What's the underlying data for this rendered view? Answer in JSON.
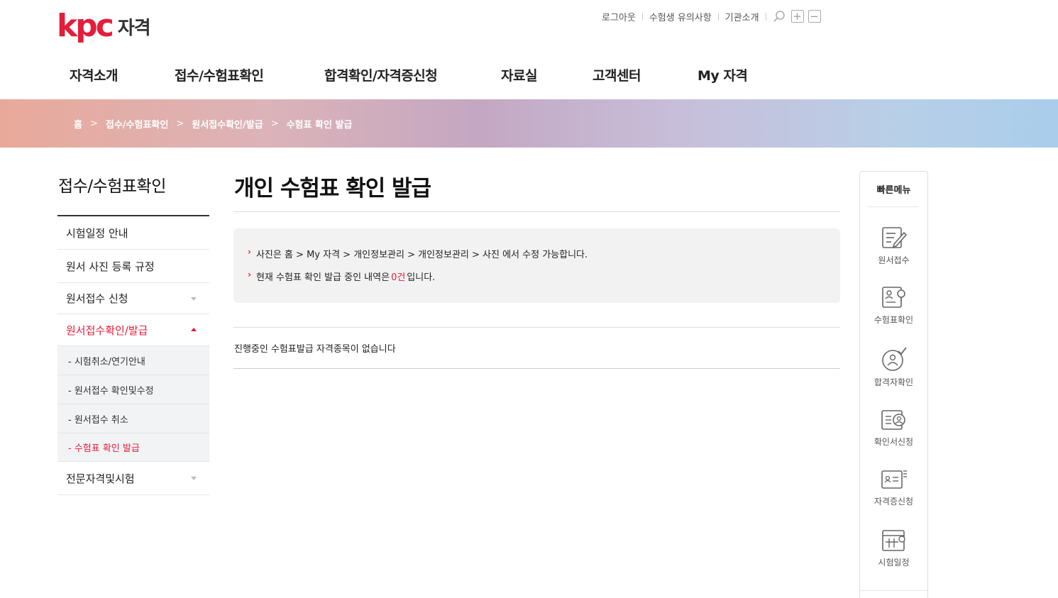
{
  "logo": {
    "brand": "kpc",
    "sub": "자격"
  },
  "util": {
    "logout": "로그아웃",
    "notice": "수험생 유의사항",
    "about": "기관소개",
    "zoom_in": "+",
    "zoom_out": "−"
  },
  "gnb": [
    "자격소개",
    "접수/수험표확인",
    "합격확인/자격증신청",
    "자료실",
    "고객센터",
    "My 자격"
  ],
  "breadcrumb": {
    "home": "홈",
    "level1": "접수/수험표확인",
    "level2": "원서접수확인/발급",
    "level3": "수험표 확인 발급",
    "arrow": ">"
  },
  "lnb": {
    "title": "접수/수험표확인",
    "items": [
      {
        "label": "시험일정 안내"
      },
      {
        "label": "원서 사진 등록 규정"
      },
      {
        "label": "원서접수 신청"
      },
      {
        "label": "원서접수확인/발급"
      },
      {
        "label": "전문자격및시험"
      }
    ],
    "sub_items": [
      {
        "label": "- 시험취소/연기안내"
      },
      {
        "label": "- 원서접수 확인및수정"
      },
      {
        "label": "- 원서접수 취소"
      },
      {
        "label": "- 수험표 확인 발급"
      }
    ]
  },
  "main": {
    "title": "개인 수험표 확인 발급",
    "info": {
      "line1": "사진은 홈 > My 자격 > 개인정보관리 > 개인정보관리 > 사진 에서 수정 가능합니다.",
      "line2_prefix": "현재 수험표 확인 발급 중인 내역은",
      "line2_count": "0건",
      "line2_suffix": "입니다."
    },
    "empty_message": "진행중인 수험표발급 자격종목이 없습니다"
  },
  "quick_menu": {
    "title": "빠른메뉴",
    "items": [
      {
        "label": "원서접수",
        "icon": "application-icon"
      },
      {
        "label": "수험표확인",
        "icon": "exam-ticket-icon"
      },
      {
        "label": "합격자확인",
        "icon": "pass-check-icon"
      },
      {
        "label": "확인서신청",
        "icon": "certificate-request-icon"
      },
      {
        "label": "자격증신청",
        "icon": "license-card-icon"
      },
      {
        "label": "시험일정",
        "icon": "calendar-icon"
      }
    ]
  },
  "colors": {
    "accent": "#e31d3b"
  }
}
